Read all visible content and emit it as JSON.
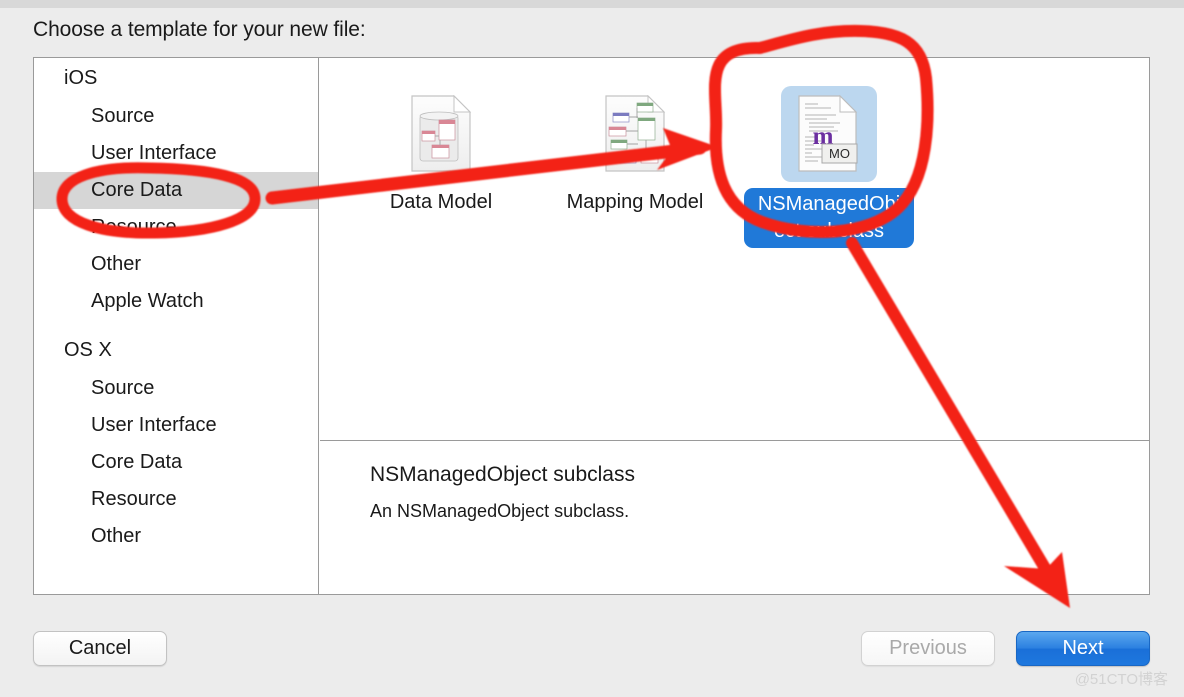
{
  "dialog": {
    "prompt": "Choose a template for your new file:"
  },
  "sidebar": {
    "groups": [
      {
        "name": "iOS",
        "items": [
          {
            "label": "Source",
            "selected": false
          },
          {
            "label": "User Interface",
            "selected": false
          },
          {
            "label": "Core Data",
            "selected": true
          },
          {
            "label": "Resource",
            "selected": false
          },
          {
            "label": "Other",
            "selected": false
          },
          {
            "label": "Apple Watch",
            "selected": false
          }
        ]
      },
      {
        "name": "OS X",
        "items": [
          {
            "label": "Source",
            "selected": false
          },
          {
            "label": "User Interface",
            "selected": false
          },
          {
            "label": "Core Data",
            "selected": false
          },
          {
            "label": "Resource",
            "selected": false
          },
          {
            "label": "Other",
            "selected": false
          }
        ]
      }
    ]
  },
  "templates": [
    {
      "label": "Data Model",
      "icon": "data-model-document-icon",
      "selected": false
    },
    {
      "label": "Mapping Model",
      "icon": "mapping-model-document-icon",
      "selected": false
    },
    {
      "label": "NSManagedObject subclass",
      "icon": "nsmanagedobject-source-icon",
      "selected": true
    }
  ],
  "description": {
    "title": "NSManagedObject subclass",
    "body": "An NSManagedObject subclass."
  },
  "footer": {
    "cancel_label": "Cancel",
    "previous_label": "Previous",
    "next_label": "Next"
  },
  "watermark": {
    "text": "@51CTO博客"
  },
  "colors": {
    "selection_blue": "#2079d8",
    "icon_selection_blue": "#bcd7ef",
    "sidebar_selection_gray": "#d6d6d6",
    "primary_button_blue": "#2a7fe0",
    "annotation_red": "#f32113",
    "window_background": "#ececec",
    "panel_background": "#ffffff"
  },
  "annotations": {
    "oval_core_data": "red-oval-around-core-data",
    "arrow_to_template": "red-arrow-core-data-to-template",
    "circle_template": "red-circle-around-nsmanagedobject-template",
    "arrow_to_next": "red-arrow-template-to-next-button"
  }
}
